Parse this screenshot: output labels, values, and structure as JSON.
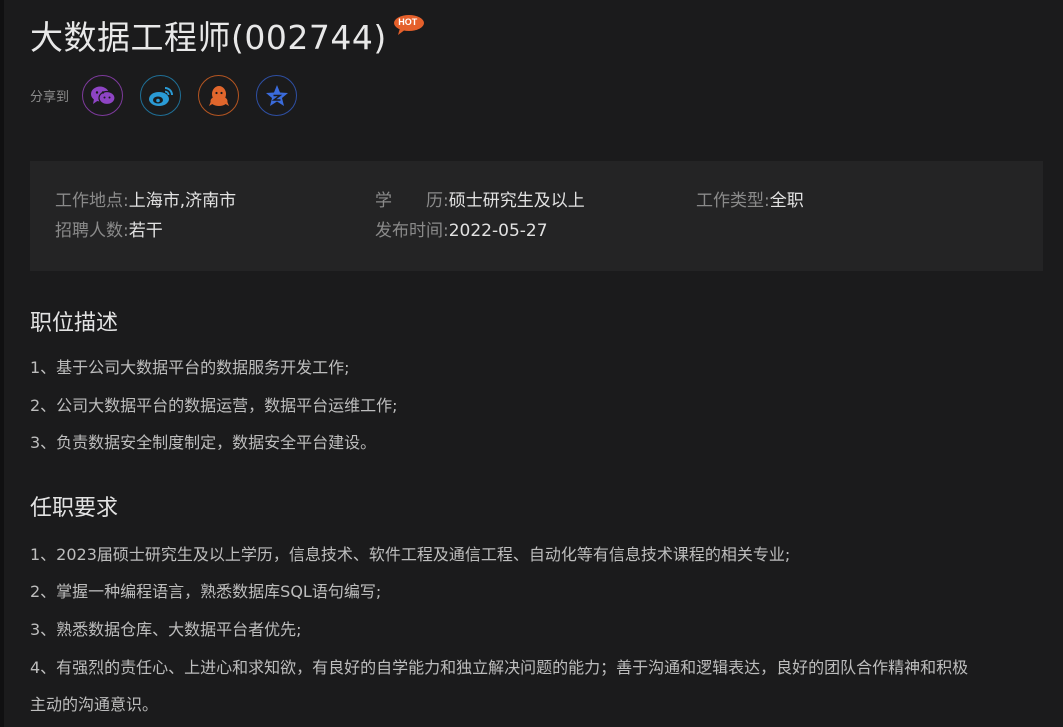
{
  "job": {
    "title": "大数据工程师(002744)",
    "hot_badge": "HOT"
  },
  "share": {
    "label": "分享到",
    "buttons": [
      {
        "name": "wechat",
        "icon": "wechat-icon",
        "color": "#8e44c4"
      },
      {
        "name": "weibo",
        "icon": "weibo-icon",
        "color": "#2a9bd6"
      },
      {
        "name": "qq",
        "icon": "qq-icon",
        "color": "#e0662c"
      },
      {
        "name": "qzone",
        "icon": "qzone-icon",
        "color": "#3a6bdc"
      }
    ]
  },
  "info": {
    "location_label": "工作地点:",
    "location_value": "上海市,济南市",
    "education_label": "学　　历:",
    "education_value": "硕士研究生及以上",
    "type_label": "工作类型:",
    "type_value": "全职",
    "headcount_label": "招聘人数:",
    "headcount_value": "若干",
    "date_label": "发布时间:",
    "date_value": "2022-05-27"
  },
  "description": {
    "title": "职位描述",
    "lines": [
      "1、基于公司大数据平台的数据服务开发工作;",
      "2、公司大数据平台的数据运营，数据平台运维工作;",
      "3、负责数据安全制度制定，数据安全平台建设。"
    ]
  },
  "requirements": {
    "title": "任职要求",
    "lines": [
      "1、2023届硕士研究生及以上学历，信息技术、软件工程及通信工程、自动化等有信息技术课程的相关专业;",
      "2、掌握一种编程语言，熟悉数据库SQL语句编写;",
      "3、熟悉数据仓库、大数据平台者优先;",
      "4、有强烈的责任心、上进心和求知欲，有良好的自学能力和独立解决问题的能力；善于沟通和逻辑表达，良好的团队合作精神和积极",
      "主动的沟通意识。"
    ]
  }
}
